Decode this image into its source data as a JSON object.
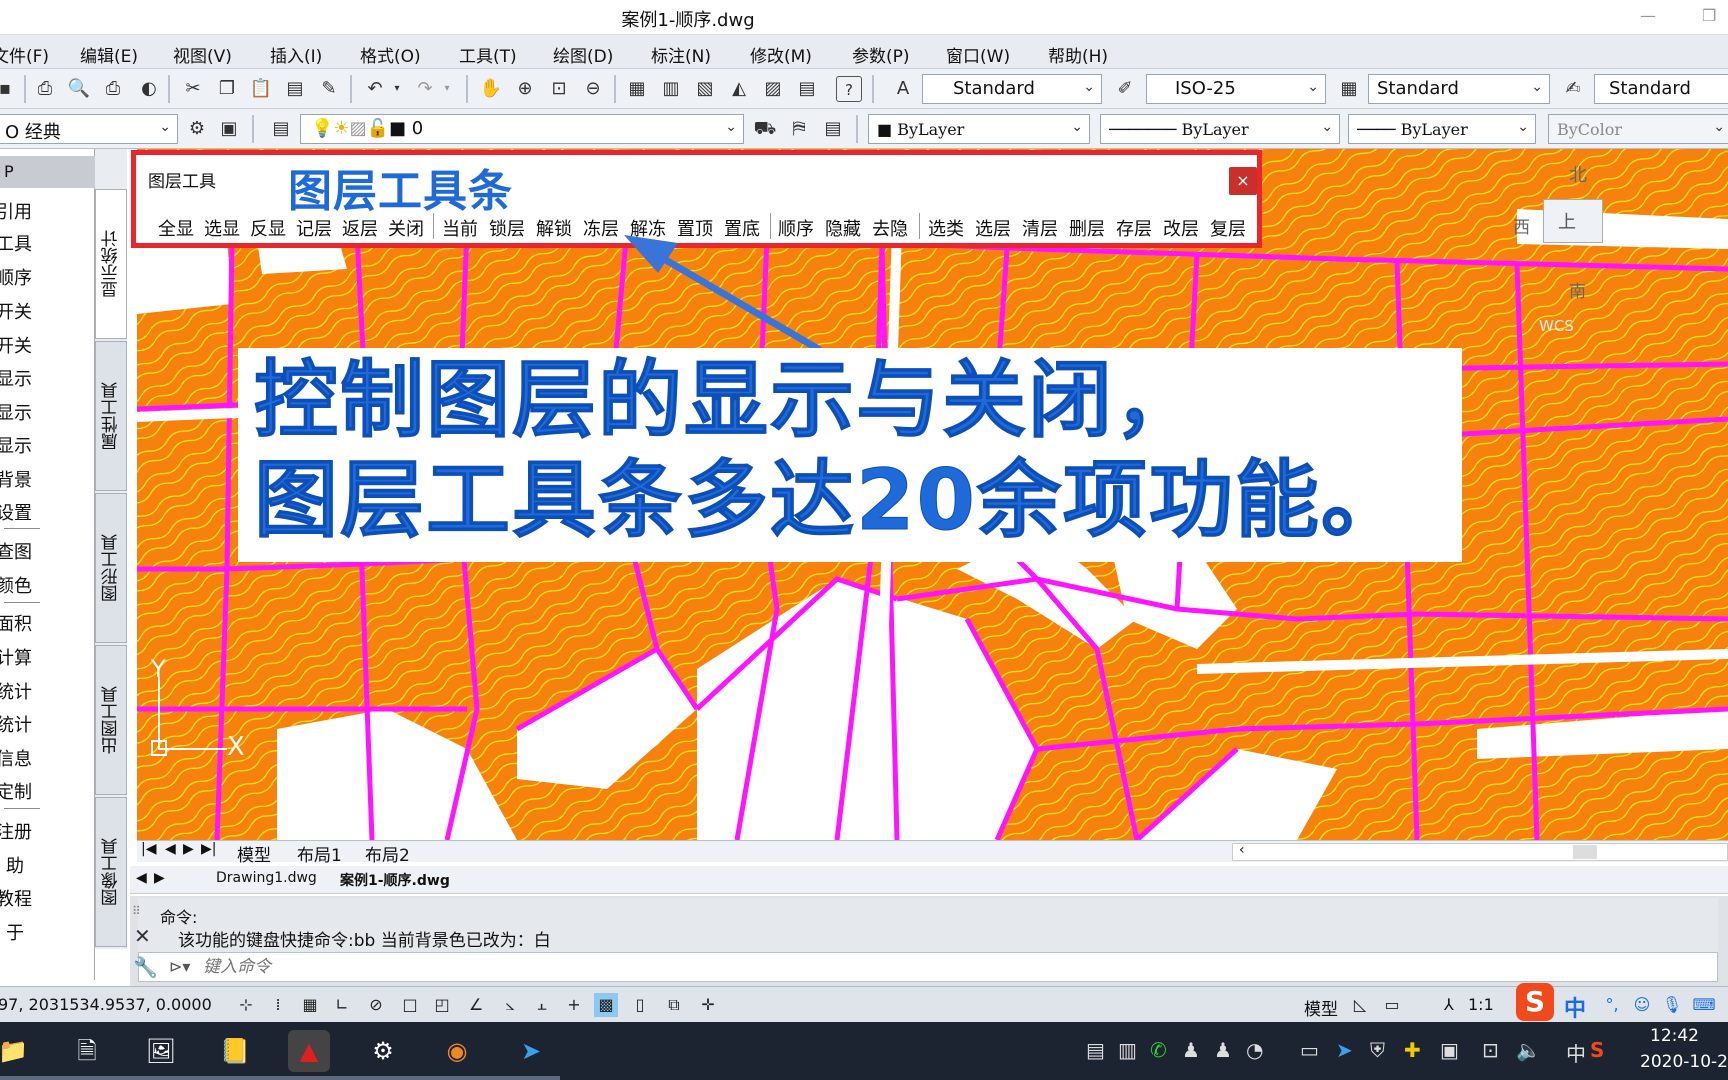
{
  "window": {
    "title": "案例1-顺序.dwg",
    "min_icon": "minimize-icon",
    "max_icon": "maximize-icon"
  },
  "menu": [
    "文件(F)",
    "编辑(E)",
    "视图(V)",
    "插入(I)",
    "格式(O)",
    "工具(T)",
    "绘图(D)",
    "标注(N)",
    "修改(M)",
    "参数(P)",
    "窗口(W)",
    "帮助(H)"
  ],
  "toolbar1": {
    "text_style": "Standard",
    "dim_style": "ISO-25",
    "table_style": "Standard",
    "mleader_style": "Standard"
  },
  "toolbar2": {
    "workspace": "O 经典",
    "layer": "0",
    "color": "ByLayer",
    "linetype": "ByLayer",
    "lineweight": "ByLayer",
    "plotstyle": "ByColor"
  },
  "left_panel": {
    "header": "P",
    "items": [
      "引用",
      "工具",
      "顺序",
      "开关",
      "开关",
      "显示",
      "显示",
      "显示",
      "背景",
      "设置",
      "查图",
      "颜色",
      "面积",
      "计算",
      "统计",
      "统计",
      "信息",
      "定制",
      "注册",
      "助",
      "教程",
      "于"
    ]
  },
  "vertical_tabs": [
    "显示统计",
    "属性工具",
    "图形工具",
    "出图工具",
    "图像工具"
  ],
  "layer_toolbar": {
    "title": "图层工具",
    "caption": "图层工具条",
    "close": "×",
    "groups": [
      [
        "全显",
        "选显",
        "反显",
        "记层",
        "返层",
        "关闭"
      ],
      [
        "当前",
        "锁层",
        "解锁",
        "冻层",
        "解冻",
        "置顶",
        "置底"
      ],
      [
        "顺序",
        "隐藏",
        "去隐"
      ],
      [
        "选类",
        "选层",
        "清层",
        "删层",
        "存层",
        "改层",
        "复层"
      ]
    ]
  },
  "big_caption": {
    "line1": "控制图层的显示与关闭，",
    "line2": "图层工具条多达20余项功能。"
  },
  "compass": {
    "north": "北",
    "west": "西",
    "south": "南",
    "top": "上",
    "wcs": "WCS"
  },
  "axis": {
    "y": "Y",
    "x": "X"
  },
  "layout_tabs": [
    "模型",
    "布局1",
    "布局2"
  ],
  "file_tabs": [
    "Drawing1.dwg",
    "案例1-顺序.dwg"
  ],
  "command": {
    "line1": "命令:",
    "line2": "该功能的键盘快捷命令:bb 当前背景色已改为：白",
    "placeholder": "键入命令"
  },
  "status": {
    "coords": "97, 2031534.9537, 0.0000",
    "model": "模型",
    "scale": "1:1"
  },
  "taskbar": {
    "time": "12:42",
    "date": "2020-10-2",
    "ime": "中"
  }
}
